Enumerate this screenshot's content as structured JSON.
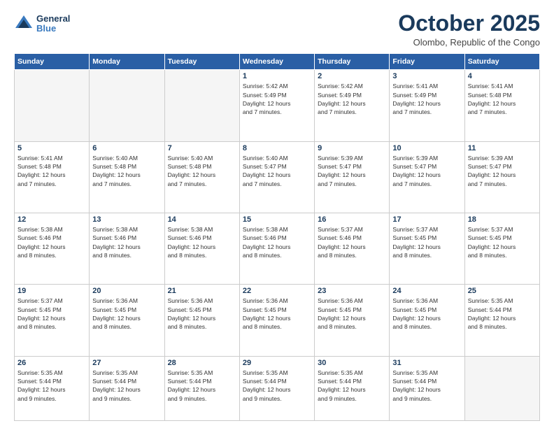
{
  "header": {
    "logo": {
      "line1": "General",
      "line2": "Blue"
    },
    "title": "October 2025",
    "location": "Olombo, Republic of the Congo"
  },
  "weekdays": [
    "Sunday",
    "Monday",
    "Tuesday",
    "Wednesday",
    "Thursday",
    "Friday",
    "Saturday"
  ],
  "weeks": [
    [
      {
        "day": "",
        "info": ""
      },
      {
        "day": "",
        "info": ""
      },
      {
        "day": "",
        "info": ""
      },
      {
        "day": "1",
        "info": "Sunrise: 5:42 AM\nSunset: 5:49 PM\nDaylight: 12 hours\nand 7 minutes."
      },
      {
        "day": "2",
        "info": "Sunrise: 5:42 AM\nSunset: 5:49 PM\nDaylight: 12 hours\nand 7 minutes."
      },
      {
        "day": "3",
        "info": "Sunrise: 5:41 AM\nSunset: 5:49 PM\nDaylight: 12 hours\nand 7 minutes."
      },
      {
        "day": "4",
        "info": "Sunrise: 5:41 AM\nSunset: 5:48 PM\nDaylight: 12 hours\nand 7 minutes."
      }
    ],
    [
      {
        "day": "5",
        "info": "Sunrise: 5:41 AM\nSunset: 5:48 PM\nDaylight: 12 hours\nand 7 minutes."
      },
      {
        "day": "6",
        "info": "Sunrise: 5:40 AM\nSunset: 5:48 PM\nDaylight: 12 hours\nand 7 minutes."
      },
      {
        "day": "7",
        "info": "Sunrise: 5:40 AM\nSunset: 5:48 PM\nDaylight: 12 hours\nand 7 minutes."
      },
      {
        "day": "8",
        "info": "Sunrise: 5:40 AM\nSunset: 5:47 PM\nDaylight: 12 hours\nand 7 minutes."
      },
      {
        "day": "9",
        "info": "Sunrise: 5:39 AM\nSunset: 5:47 PM\nDaylight: 12 hours\nand 7 minutes."
      },
      {
        "day": "10",
        "info": "Sunrise: 5:39 AM\nSunset: 5:47 PM\nDaylight: 12 hours\nand 7 minutes."
      },
      {
        "day": "11",
        "info": "Sunrise: 5:39 AM\nSunset: 5:47 PM\nDaylight: 12 hours\nand 7 minutes."
      }
    ],
    [
      {
        "day": "12",
        "info": "Sunrise: 5:38 AM\nSunset: 5:46 PM\nDaylight: 12 hours\nand 8 minutes."
      },
      {
        "day": "13",
        "info": "Sunrise: 5:38 AM\nSunset: 5:46 PM\nDaylight: 12 hours\nand 8 minutes."
      },
      {
        "day": "14",
        "info": "Sunrise: 5:38 AM\nSunset: 5:46 PM\nDaylight: 12 hours\nand 8 minutes."
      },
      {
        "day": "15",
        "info": "Sunrise: 5:38 AM\nSunset: 5:46 PM\nDaylight: 12 hours\nand 8 minutes."
      },
      {
        "day": "16",
        "info": "Sunrise: 5:37 AM\nSunset: 5:46 PM\nDaylight: 12 hours\nand 8 minutes."
      },
      {
        "day": "17",
        "info": "Sunrise: 5:37 AM\nSunset: 5:45 PM\nDaylight: 12 hours\nand 8 minutes."
      },
      {
        "day": "18",
        "info": "Sunrise: 5:37 AM\nSunset: 5:45 PM\nDaylight: 12 hours\nand 8 minutes."
      }
    ],
    [
      {
        "day": "19",
        "info": "Sunrise: 5:37 AM\nSunset: 5:45 PM\nDaylight: 12 hours\nand 8 minutes."
      },
      {
        "day": "20",
        "info": "Sunrise: 5:36 AM\nSunset: 5:45 PM\nDaylight: 12 hours\nand 8 minutes."
      },
      {
        "day": "21",
        "info": "Sunrise: 5:36 AM\nSunset: 5:45 PM\nDaylight: 12 hours\nand 8 minutes."
      },
      {
        "day": "22",
        "info": "Sunrise: 5:36 AM\nSunset: 5:45 PM\nDaylight: 12 hours\nand 8 minutes."
      },
      {
        "day": "23",
        "info": "Sunrise: 5:36 AM\nSunset: 5:45 PM\nDaylight: 12 hours\nand 8 minutes."
      },
      {
        "day": "24",
        "info": "Sunrise: 5:36 AM\nSunset: 5:45 PM\nDaylight: 12 hours\nand 8 minutes."
      },
      {
        "day": "25",
        "info": "Sunrise: 5:35 AM\nSunset: 5:44 PM\nDaylight: 12 hours\nand 8 minutes."
      }
    ],
    [
      {
        "day": "26",
        "info": "Sunrise: 5:35 AM\nSunset: 5:44 PM\nDaylight: 12 hours\nand 9 minutes."
      },
      {
        "day": "27",
        "info": "Sunrise: 5:35 AM\nSunset: 5:44 PM\nDaylight: 12 hours\nand 9 minutes."
      },
      {
        "day": "28",
        "info": "Sunrise: 5:35 AM\nSunset: 5:44 PM\nDaylight: 12 hours\nand 9 minutes."
      },
      {
        "day": "29",
        "info": "Sunrise: 5:35 AM\nSunset: 5:44 PM\nDaylight: 12 hours\nand 9 minutes."
      },
      {
        "day": "30",
        "info": "Sunrise: 5:35 AM\nSunset: 5:44 PM\nDaylight: 12 hours\nand 9 minutes."
      },
      {
        "day": "31",
        "info": "Sunrise: 5:35 AM\nSunset: 5:44 PM\nDaylight: 12 hours\nand 9 minutes."
      },
      {
        "day": "",
        "info": ""
      }
    ]
  ]
}
